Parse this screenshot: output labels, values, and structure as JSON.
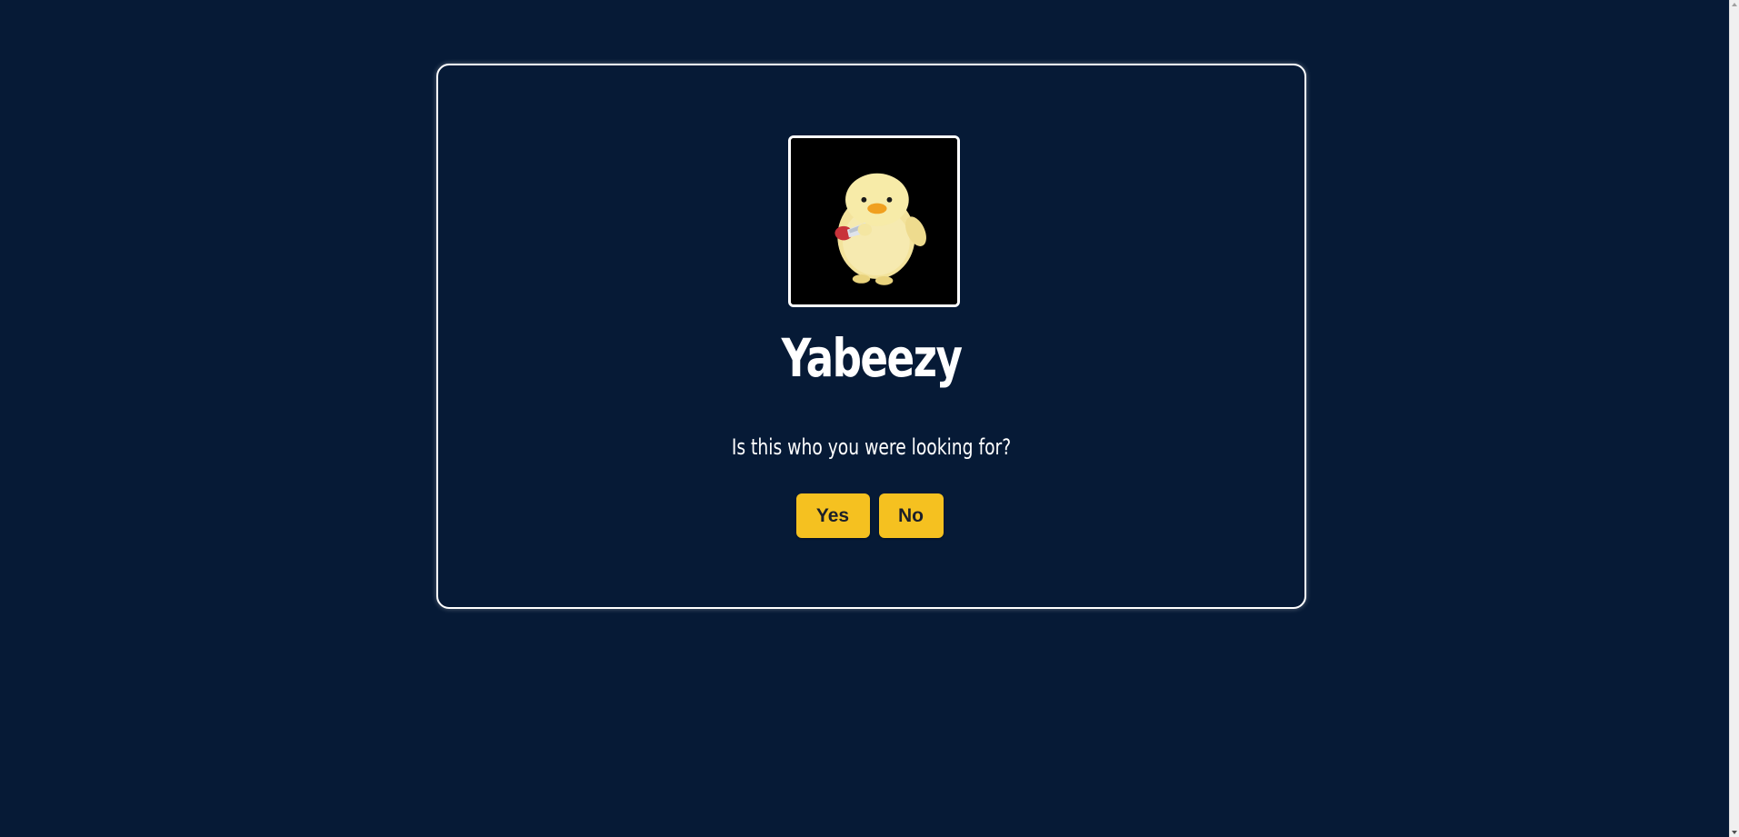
{
  "profile": {
    "username": "Yabeezy",
    "avatar_icon": "duck-with-knife-image"
  },
  "prompt": {
    "question": "Is this who you were looking for?"
  },
  "actions": {
    "yes_label": "Yes",
    "no_label": "No"
  },
  "colors": {
    "background": "#061a36",
    "card_border": "#ffffff",
    "button": "#f5c120",
    "button_text": "#1b1f2a",
    "text": "#ffffff"
  }
}
